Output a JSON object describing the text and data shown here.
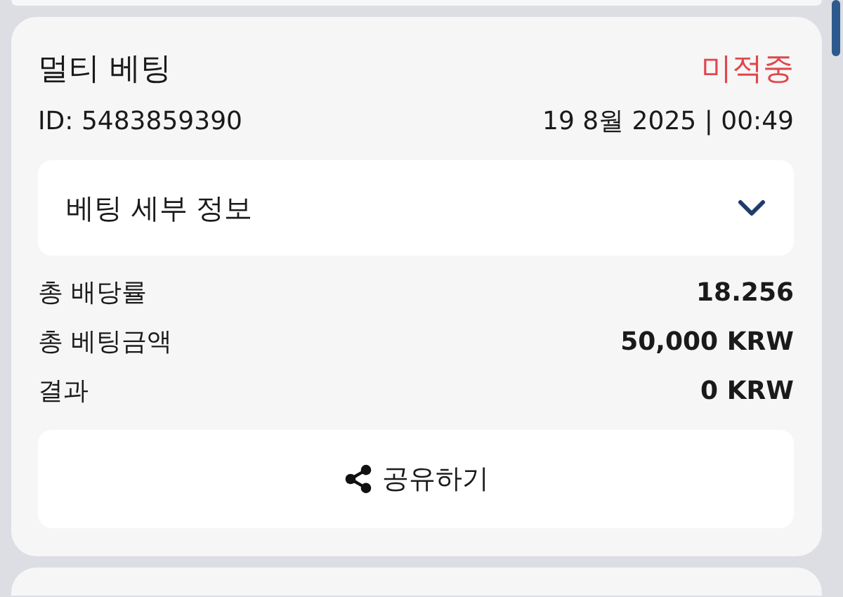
{
  "bet": {
    "title": "멀티 베팅",
    "status": "미적중",
    "id": "ID: 5483859390",
    "datetime": "19 8월 2025 | 00:49"
  },
  "details": {
    "label": "베팅 세부 정보",
    "expanded": false
  },
  "summary": [
    {
      "label": "총 배당률",
      "value": "18.256"
    },
    {
      "label": "총 베팅금액",
      "value": "50,000 KRW"
    },
    {
      "label": "결과",
      "value": "0 KRW"
    }
  ],
  "share_button": "공유하기"
}
